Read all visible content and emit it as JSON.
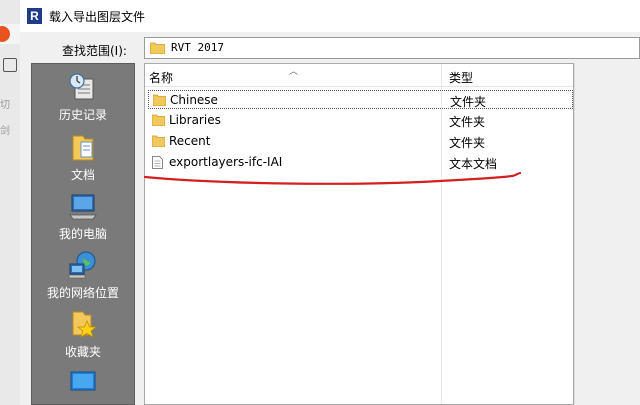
{
  "background_app": {
    "side_text_1": "切",
    "side_text_2": "剑"
  },
  "dialog": {
    "app_icon_letter": "R",
    "title": "载入导出图层文件",
    "look_in_label": "查找范围(I):",
    "look_in_value": "RVT 2017"
  },
  "places": [
    {
      "label": "历史记录",
      "icon": "history-icon"
    },
    {
      "label": "文档",
      "icon": "documents-icon"
    },
    {
      "label": "我的电脑",
      "icon": "computer-icon"
    },
    {
      "label": "我的网络位置",
      "icon": "network-icon"
    },
    {
      "label": "收藏夹",
      "icon": "favorites-icon"
    },
    {
      "label": "",
      "icon": "desktop-icon"
    }
  ],
  "file_list": {
    "columns": {
      "name": "名称",
      "type": "类型"
    },
    "rows": [
      {
        "name": "Chinese",
        "type": "文件夹",
        "icon": "folder-icon",
        "selected": true
      },
      {
        "name": "Libraries",
        "type": "文件夹",
        "icon": "folder-icon",
        "selected": false
      },
      {
        "name": "Recent",
        "type": "文件夹",
        "icon": "folder-icon",
        "selected": false
      },
      {
        "name": "exportlayers-ifc-IAI",
        "type": "文本文档",
        "icon": "text-file-icon",
        "selected": false
      }
    ]
  },
  "colors": {
    "annotation": "#d42020",
    "places_bg": "#7a7a7a",
    "folder": "#f3c85a"
  }
}
